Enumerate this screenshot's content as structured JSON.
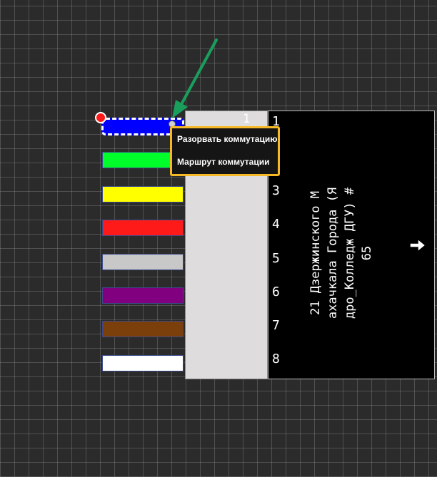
{
  "fibers": [
    {
      "color": "#0000ff",
      "selected": true
    },
    {
      "color": "#00ff2a"
    },
    {
      "color": "#ffff00"
    },
    {
      "color": "#ff1a1a"
    },
    {
      "color": "#c8c8c8"
    },
    {
      "color": "#800080"
    },
    {
      "color": "#7a3f0a"
    },
    {
      "color": "#ffffff"
    }
  ],
  "port_strip": {
    "top_number": "1"
  },
  "ports": [
    "1",
    "2",
    "3",
    "4",
    "5",
    "6",
    "7",
    "8"
  ],
  "cable": {
    "label_lines": [
      "21 Дзержинского М",
      "ахачкала Города (Я",
      "дро_Колледж ДГУ) #",
      "65"
    ]
  },
  "context_menu": {
    "items": [
      "Разорвать коммутацию",
      "Маршрут коммутации"
    ],
    "border_color": "#f6b824"
  },
  "annotation": {
    "arrow_color": "#1a9e5c"
  },
  "icons": {
    "end_marker": "red-circle-marker",
    "nav": "arrow-right-icon"
  }
}
